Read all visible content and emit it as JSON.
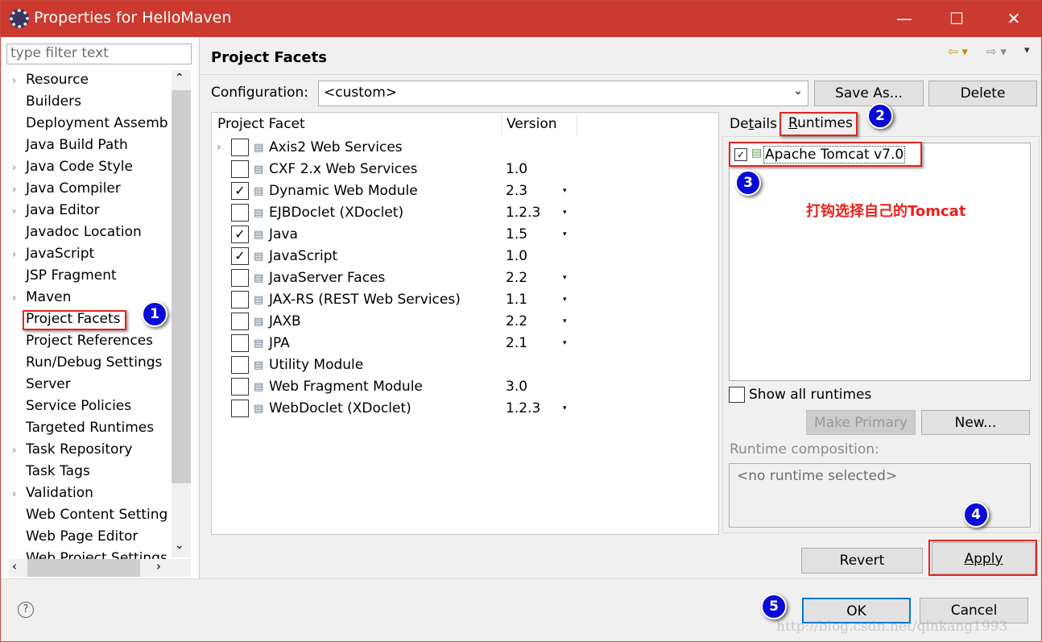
{
  "window": {
    "title": "Properties for HelloMaven",
    "controls": [
      "minimize",
      "maximize",
      "close"
    ]
  },
  "left": {
    "filter_placeholder": "type filter text",
    "items": [
      {
        "label": "Resource",
        "expandable": true
      },
      {
        "label": "Builders"
      },
      {
        "label": "Deployment Assemb"
      },
      {
        "label": "Java Build Path"
      },
      {
        "label": "Java Code Style",
        "expandable": true
      },
      {
        "label": "Java Compiler",
        "expandable": true
      },
      {
        "label": "Java Editor",
        "expandable": true
      },
      {
        "label": "Javadoc Location"
      },
      {
        "label": "JavaScript",
        "expandable": true
      },
      {
        "label": "JSP Fragment"
      },
      {
        "label": "Maven",
        "expandable": true
      },
      {
        "label": "Project Facets",
        "selected": true
      },
      {
        "label": "Project References"
      },
      {
        "label": "Run/Debug Settings"
      },
      {
        "label": "Server"
      },
      {
        "label": "Service Policies"
      },
      {
        "label": "Targeted Runtimes"
      },
      {
        "label": "Task Repository",
        "expandable": true
      },
      {
        "label": "Task Tags"
      },
      {
        "label": "Validation",
        "expandable": true
      },
      {
        "label": "Web Content Setting"
      },
      {
        "label": "Web Page Editor"
      },
      {
        "label": "Web Project Settings"
      }
    ]
  },
  "page": {
    "title": "Project Facets",
    "config_label": "Configuration:",
    "config_value": "<custom>",
    "save_as": "Save As...",
    "delete": "Delete"
  },
  "facets": {
    "col_facet": "Project Facet",
    "col_version": "Version",
    "rows": [
      {
        "name": "Axis2 Web Services",
        "version": "",
        "checked": false,
        "expandable": true,
        "dropdown": false
      },
      {
        "name": "CXF 2.x Web Services",
        "version": "1.0",
        "checked": false,
        "dropdown": false
      },
      {
        "name": "Dynamic Web Module",
        "version": "2.3",
        "checked": true,
        "dropdown": true
      },
      {
        "name": "EJBDoclet (XDoclet)",
        "version": "1.2.3",
        "checked": false,
        "dropdown": true
      },
      {
        "name": "Java",
        "version": "1.5",
        "checked": true,
        "dropdown": true
      },
      {
        "name": "JavaScript",
        "version": "1.0",
        "checked": true,
        "dropdown": false
      },
      {
        "name": "JavaServer Faces",
        "version": "2.2",
        "checked": false,
        "dropdown": true
      },
      {
        "name": "JAX-RS (REST Web Services)",
        "version": "1.1",
        "checked": false,
        "dropdown": true
      },
      {
        "name": "JAXB",
        "version": "2.2",
        "checked": false,
        "dropdown": true
      },
      {
        "name": "JPA",
        "version": "2.1",
        "checked": false,
        "dropdown": true
      },
      {
        "name": "Utility Module",
        "version": "",
        "checked": false,
        "dropdown": false
      },
      {
        "name": "Web Fragment Module",
        "version": "3.0",
        "checked": false,
        "dropdown": false
      },
      {
        "name": "WebDoclet (XDoclet)",
        "version": "1.2.3",
        "checked": false,
        "dropdown": true
      }
    ]
  },
  "runtimes": {
    "tab_details": "Details",
    "tab_runtimes": "Runtimes",
    "items": [
      {
        "name": "Apache Tomcat v7.0",
        "checked": true
      }
    ],
    "annotation": "打钩选择自己的Tomcat",
    "show_all": "Show all runtimes",
    "make_primary": "Make Primary",
    "new": "New...",
    "composition_label": "Runtime composition:",
    "composition_value": "<no runtime selected>"
  },
  "buttons": {
    "revert": "Revert",
    "apply": "Apply",
    "ok": "OK",
    "cancel": "Cancel",
    "help": "?"
  },
  "badges": [
    "1",
    "2",
    "3",
    "4",
    "5"
  ],
  "watermark": "http://blog.csdn.net/qinkang1993",
  "colors": {
    "titlebar": "#cc3a2f",
    "annotation_red": "#e8221d",
    "badge_blue": "#0a0ad8",
    "focus": "#0078d7"
  }
}
